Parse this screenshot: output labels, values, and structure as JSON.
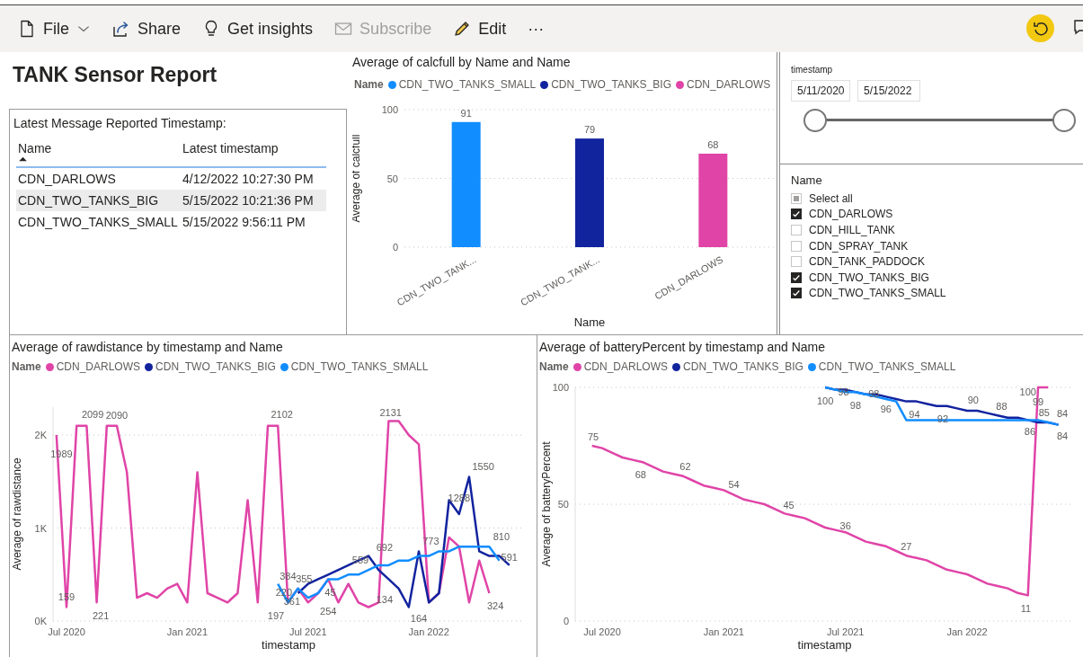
{
  "toolbar": {
    "items": [
      {
        "label": "File",
        "dropdown": true,
        "disabled": false
      },
      {
        "label": "Share",
        "dropdown": false,
        "disabled": false
      },
      {
        "label": "Get insights",
        "dropdown": false,
        "disabled": false
      },
      {
        "label": "Subscribe",
        "dropdown": false,
        "disabled": true
      },
      {
        "label": "Edit",
        "dropdown": false,
        "disabled": false
      }
    ],
    "more": "···"
  },
  "report_title": "TANK Sensor Report",
  "table": {
    "caption": "Latest Message Reported Timestamp:",
    "columns": [
      {
        "label": "Name",
        "sorted": true
      },
      {
        "label": "Latest timestamp",
        "sorted": false
      }
    ],
    "rows": [
      {
        "cells": [
          "CDN_DARLOWS",
          "4/12/2022 10:27:30 PM"
        ],
        "highlighted": false
      },
      {
        "cells": [
          "CDN_TWO_TANKS_BIG",
          "5/15/2022 10:21:36 PM"
        ],
        "highlighted": true
      },
      {
        "cells": [
          "CDN_TWO_TANKS_SMALL",
          "5/15/2022 9:56:11 PM"
        ],
        "highlighted": false
      }
    ]
  },
  "bar_chart": {
    "legend_title": "Name",
    "chart_data": {
      "type": "bar",
      "title": "Average of calcfull by Name and Name",
      "xlabel": "Name",
      "ylabel": "Average of calcfull",
      "categories": [
        "CDN_TWO_TANK...",
        "CDN_TWO_TANK...",
        "CDN_DARLOWS"
      ],
      "series": [
        {
          "name": "CDN_TWO_TANKS_SMALL",
          "color": "#118dff",
          "values": [
            91,
            null,
            null
          ]
        },
        {
          "name": "CDN_TWO_TANKS_BIG",
          "color": "#12239e",
          "values": [
            null,
            79,
            null
          ]
        },
        {
          "name": "CDN_DARLOWS",
          "color": "#e044a7",
          "values": [
            null,
            null,
            68
          ]
        }
      ],
      "ylim": [
        0,
        100
      ],
      "yticks": [
        0,
        50,
        100
      ],
      "data_labels": true
    }
  },
  "date_slicer": {
    "label": "timestamp",
    "start": "5/11/2020",
    "end": "5/15/2022",
    "thumbs": [
      {
        "level": 0
      },
      {
        "level": 1
      }
    ]
  },
  "name_slicer": {
    "title": "Name",
    "select_all": {
      "label": "Select all",
      "partial": true
    },
    "items": [
      {
        "label": "CDN_DARLOWS",
        "checked": true
      },
      {
        "label": "CDN_HILL_TANK",
        "checked": false
      },
      {
        "label": "CDN_SPRAY_TANK",
        "checked": false
      },
      {
        "label": "CDN_TANK_PADDOCK",
        "checked": false
      },
      {
        "label": "CDN_TWO_TANKS_BIG",
        "checked": true
      },
      {
        "label": "CDN_TWO_TANKS_SMALL",
        "checked": true
      }
    ]
  },
  "rawdistance_chart": {
    "legend_title": "Name",
    "chart_data": {
      "type": "line",
      "title": "Average of rawdistance by timestamp and Name",
      "xlabel": "timestamp",
      "ylabel": "Average of rawdistance",
      "categories": [
        null,
        "Jul 2020",
        null,
        null,
        null,
        null,
        null,
        null,
        null,
        null,
        null,
        null,
        null,
        "Jan 2021",
        null,
        null,
        null,
        null,
        null,
        null,
        null,
        null,
        null,
        null,
        null,
        "Jul 2021",
        null,
        null,
        null,
        null,
        null,
        null,
        null,
        null,
        null,
        null,
        null,
        "Jan 2022",
        null,
        null,
        null,
        null,
        null,
        null,
        null,
        null
      ],
      "series": [
        {
          "name": "CDN_DARLOWS",
          "color": "#e044a7",
          "values": [
            2000,
            150,
            2100,
            2100,
            200,
            2100,
            2100,
            1600,
            250,
            300,
            250,
            350,
            400,
            200,
            1600,
            300,
            250,
            200,
            300,
            1300,
            200,
            2100,
            2100,
            200,
            350,
            200,
            300,
            450,
            200,
            400,
            200,
            150,
            200,
            2150,
            2150,
            2000,
            1900,
            200,
            300,
            900,
            800,
            200,
            650,
            300,
            null,
            null
          ]
        },
        {
          "name": "CDN_TWO_TANKS_BIG",
          "color": "#12239e",
          "values": [
            null,
            null,
            null,
            null,
            null,
            null,
            null,
            null,
            null,
            null,
            null,
            null,
            null,
            null,
            null,
            null,
            null,
            null,
            null,
            null,
            null,
            null,
            null,
            null,
            300,
            400,
            450,
            500,
            550,
            600,
            650,
            700,
            550,
            450,
            350,
            150,
            750,
            200,
            300,
            1300,
            1150,
            1550,
            750,
            700,
            700,
            600
          ]
        },
        {
          "name": "CDN_TWO_TANKS_SMALL",
          "color": "#118dff",
          "values": [
            null,
            null,
            null,
            null,
            null,
            null,
            null,
            null,
            null,
            null,
            null,
            null,
            null,
            null,
            null,
            null,
            null,
            null,
            null,
            null,
            null,
            null,
            400,
            200,
            350,
            250,
            300,
            450,
            450,
            500,
            500,
            550,
            600,
            600,
            650,
            650,
            700,
            700,
            750,
            750,
            800,
            800,
            800,
            800,
            650,
            null
          ]
        }
      ],
      "ylim": [
        0,
        2300
      ],
      "yticks": [
        {
          "value": 0,
          "label": "0K"
        },
        {
          "value": 1000,
          "label": "1K"
        },
        {
          "value": 2000,
          "label": "2K"
        }
      ],
      "annotations": [
        "1989",
        "159",
        "2099",
        "2090",
        "221",
        "2102",
        "384",
        "220",
        "361",
        "197",
        "355",
        "45",
        "254",
        "559",
        "692",
        "134",
        "2131",
        "773",
        "164",
        "1288",
        "1550",
        "810",
        "591",
        "324"
      ]
    }
  },
  "battery_chart": {
    "legend_title": "Name",
    "chart_data": {
      "type": "line",
      "title": "Average of batteryPercent by timestamp and Name",
      "xlabel": "timestamp",
      "ylabel": "Average of batteryPercent",
      "categories": [
        null,
        "Jul 2020",
        null,
        null,
        null,
        null,
        null,
        null,
        null,
        null,
        null,
        null,
        null,
        "Jan 2021",
        null,
        null,
        null,
        null,
        null,
        null,
        null,
        null,
        null,
        null,
        null,
        "Jul 2021",
        null,
        null,
        null,
        null,
        null,
        null,
        null,
        null,
        null,
        null,
        null,
        "Jan 2022",
        null,
        null,
        null,
        null,
        null,
        null,
        null,
        null,
        null
      ],
      "series": [
        {
          "name": "CDN_DARLOWS",
          "color": "#e044a7",
          "values": [
            75,
            74,
            72,
            70,
            69,
            68,
            66,
            64,
            63,
            62,
            60,
            58,
            57,
            56,
            54,
            52,
            51,
            50,
            48,
            46,
            45,
            44,
            42,
            40,
            39,
            38,
            36,
            34,
            33,
            32,
            30,
            28,
            27,
            26,
            24,
            22,
            21,
            20,
            18,
            16,
            15,
            14,
            12,
            11,
            100,
            100,
            null
          ]
        },
        {
          "name": "CDN_TWO_TANKS_BIG",
          "color": "#12239e",
          "values": [
            null,
            null,
            null,
            null,
            null,
            null,
            null,
            null,
            null,
            null,
            null,
            null,
            null,
            null,
            null,
            null,
            null,
            null,
            null,
            null,
            null,
            null,
            null,
            100,
            99,
            99,
            98,
            97,
            97,
            96,
            95,
            94,
            94,
            93,
            92,
            92,
            91,
            90,
            90,
            89,
            88,
            87,
            87,
            86,
            85,
            85,
            84
          ]
        },
        {
          "name": "CDN_TWO_TANKS_SMALL",
          "color": "#118dff",
          "values": [
            null,
            null,
            null,
            null,
            null,
            null,
            null,
            null,
            null,
            null,
            null,
            null,
            null,
            null,
            null,
            null,
            null,
            null,
            null,
            null,
            null,
            null,
            null,
            100,
            99,
            98,
            98,
            97,
            96,
            95,
            94,
            86,
            86,
            86,
            86,
            86,
            86,
            86,
            86,
            86,
            86,
            86,
            86,
            86,
            86,
            85,
            84
          ]
        }
      ],
      "ylim": [
        0,
        100
      ],
      "yticks": [
        0,
        50,
        100
      ],
      "annotations": [
        "75",
        "68",
        "62",
        "54",
        "45",
        "36",
        "27",
        "11",
        "100",
        "99",
        "85",
        "84",
        "86",
        "84",
        "100",
        "98",
        "98",
        "98",
        "96",
        "94",
        "92",
        "90",
        "88"
      ]
    }
  }
}
